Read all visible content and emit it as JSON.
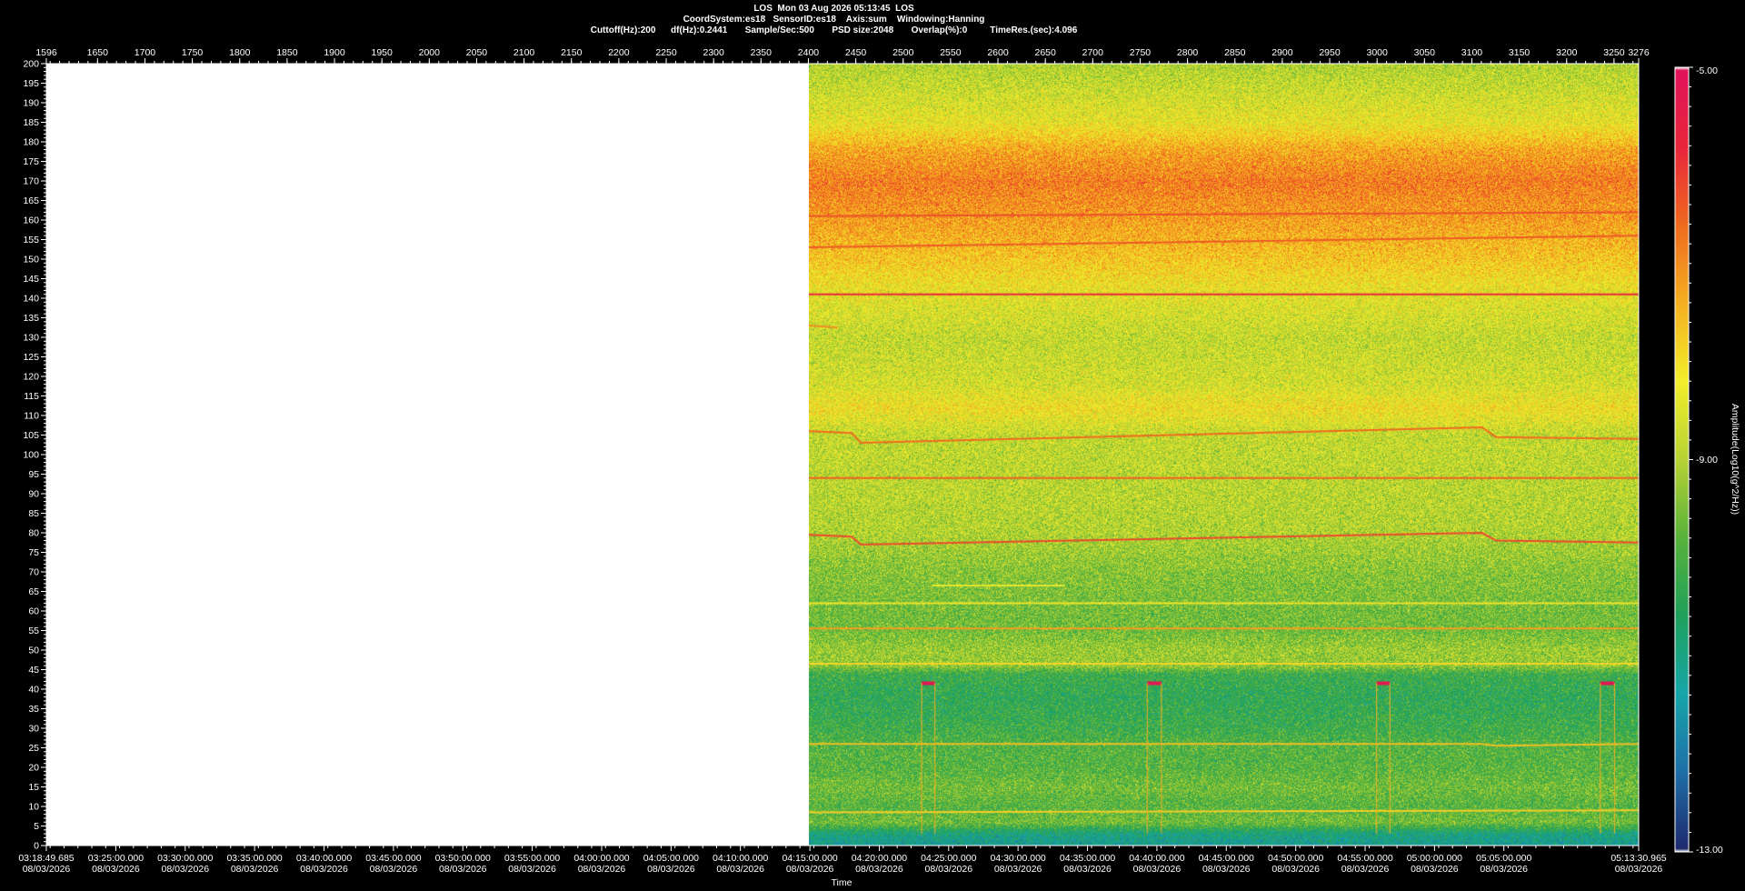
{
  "header": {
    "line1": "LOS  Mon 03 Aug 2026 05:13:45  LOS",
    "line2": "CoordSystem:es18   SensorID:es18    Axis:sum    Windowing:Hanning",
    "line3": "Cuttoff(Hz):200      df(Hz):0.2441       Sample/Sec:500       PSD size:2048       Overlap(%):0         TimeRes.(sec):4.096"
  },
  "chart_data": {
    "type": "heatmap",
    "title": "LOS  Mon 03 Aug 2026 05:13:45  LOS",
    "xlabel": "Time",
    "ylabel": "",
    "ylim": [
      0,
      200
    ],
    "y_ticks": [
      0,
      5,
      10,
      15,
      20,
      25,
      30,
      35,
      40,
      45,
      50,
      55,
      60,
      65,
      70,
      75,
      80,
      85,
      90,
      95,
      100,
      105,
      110,
      115,
      120,
      125,
      130,
      135,
      140,
      145,
      150,
      155,
      160,
      165,
      170,
      175,
      180,
      185,
      190,
      195,
      200
    ],
    "top_axis_range": [
      1596,
      3276
    ],
    "top_axis_ticks": [
      1596,
      1650,
      1700,
      1750,
      1800,
      1850,
      1900,
      1950,
      2000,
      2050,
      2100,
      2150,
      2200,
      2250,
      2300,
      2350,
      2400,
      2450,
      2500,
      2550,
      2600,
      2650,
      2700,
      2750,
      2800,
      2850,
      2900,
      2950,
      3000,
      3050,
      3100,
      3150,
      3200,
      3250,
      3276
    ],
    "data_start_index": 2400,
    "time_ticks": [
      {
        "index": 1596,
        "time": "03:18:49.685",
        "date": "08/03/2026"
      },
      {
        "index": 1669.3,
        "time": "03:25:00.000",
        "date": "08/03/2026"
      },
      {
        "index": 1742.5,
        "time": "03:30:00.000",
        "date": "08/03/2026"
      },
      {
        "index": 1815.7,
        "time": "03:35:00.000",
        "date": "08/03/2026"
      },
      {
        "index": 1889,
        "time": "03:40:00.000",
        "date": "08/03/2026"
      },
      {
        "index": 1962.2,
        "time": "03:45:00.000",
        "date": "08/03/2026"
      },
      {
        "index": 2035.4,
        "time": "03:50:00.000",
        "date": "08/03/2026"
      },
      {
        "index": 2108.6,
        "time": "03:55:00.000",
        "date": "08/03/2026"
      },
      {
        "index": 2181.9,
        "time": "04:00:00.000",
        "date": "08/03/2026"
      },
      {
        "index": 2255.1,
        "time": "04:05:00.000",
        "date": "08/03/2026"
      },
      {
        "index": 2328.3,
        "time": "04:10:00.000",
        "date": "08/03/2026"
      },
      {
        "index": 2401.6,
        "time": "04:15:00.000",
        "date": "08/03/2026"
      },
      {
        "index": 2474.8,
        "time": "04:20:00.000",
        "date": "08/03/2026"
      },
      {
        "index": 2548,
        "time": "04:25:00.000",
        "date": "08/03/2026"
      },
      {
        "index": 2621.2,
        "time": "04:30:00.000",
        "date": "08/03/2026"
      },
      {
        "index": 2694.5,
        "time": "04:35:00.000",
        "date": "08/03/2026"
      },
      {
        "index": 2767.7,
        "time": "04:40:00.000",
        "date": "08/03/2026"
      },
      {
        "index": 2840.9,
        "time": "04:45:00.000",
        "date": "08/03/2026"
      },
      {
        "index": 2914.2,
        "time": "04:50:00.000",
        "date": "08/03/2026"
      },
      {
        "index": 2987.4,
        "time": "04:55:00.000",
        "date": "08/03/2026"
      },
      {
        "index": 3060.6,
        "time": "05:00:00.000",
        "date": "08/03/2026"
      },
      {
        "index": 3133.8,
        "time": "05:05:00.000",
        "date": "08/03/2026"
      },
      {
        "index": 3276,
        "time": "05:13:30.965",
        "date": "08/03/2026"
      }
    ],
    "colorbar": {
      "label": "Amplitude(Log10(g^2/Hz))",
      "max": "-5.00",
      "mid": "-9.00",
      "min": "-13.00",
      "range": [
        -13,
        -5
      ],
      "colors": [
        "#ffffff",
        "#1e2a6e",
        "#1e6fa8",
        "#16a6a8",
        "#1ea05a",
        "#58b23a",
        "#b7d233",
        "#f2ee2a",
        "#f5b021",
        "#ef6b1e",
        "#e8263a",
        "#e0125a",
        "#ffffff"
      ]
    },
    "background_levels": [
      {
        "f": 0,
        "v": -11.3
      },
      {
        "f": 3,
        "v": -11.0
      },
      {
        "f": 6,
        "v": -9.6
      },
      {
        "f": 10,
        "v": -9.9
      },
      {
        "f": 15,
        "v": -9.6
      },
      {
        "f": 20,
        "v": -9.9
      },
      {
        "f": 25,
        "v": -9.9
      },
      {
        "f": 30,
        "v": -10.2
      },
      {
        "f": 38,
        "v": -10.4
      },
      {
        "f": 44,
        "v": -10.2
      },
      {
        "f": 46,
        "v": -9.3
      },
      {
        "f": 50,
        "v": -9.2
      },
      {
        "f": 55,
        "v": -9.6
      },
      {
        "f": 60,
        "v": -9.6
      },
      {
        "f": 70,
        "v": -9.4
      },
      {
        "f": 80,
        "v": -9.0
      },
      {
        "f": 90,
        "v": -8.9
      },
      {
        "f": 105,
        "v": -8.8
      },
      {
        "f": 112,
        "v": -8.1
      },
      {
        "f": 118,
        "v": -8.6
      },
      {
        "f": 130,
        "v": -8.8
      },
      {
        "f": 140,
        "v": -8.4
      },
      {
        "f": 150,
        "v": -7.7
      },
      {
        "f": 160,
        "v": -7.2
      },
      {
        "f": 170,
        "v": -6.8
      },
      {
        "f": 178,
        "v": -7.3
      },
      {
        "f": 185,
        "v": -8.3
      },
      {
        "f": 195,
        "v": -8.8
      },
      {
        "f": 200,
        "v": -9.0
      }
    ],
    "lines": [
      {
        "points": [
          [
            2400,
            141
          ],
          [
            3276,
            141
          ]
        ],
        "v": -5.8
      },
      {
        "points": [
          [
            2400,
            94
          ],
          [
            3276,
            94
          ]
        ],
        "v": -6.5
      },
      {
        "points": [
          [
            2400,
            161
          ],
          [
            3276,
            162
          ]
        ],
        "v": -6.3
      },
      {
        "points": [
          [
            2400,
            153
          ],
          [
            3276,
            156
          ]
        ],
        "v": -6.4
      },
      {
        "points": [
          [
            2400,
            106
          ],
          [
            2445,
            105.5
          ],
          [
            2455,
            103
          ],
          [
            3110,
            107
          ],
          [
            3125,
            104.5
          ],
          [
            3276,
            104
          ]
        ],
        "v": -6.6
      },
      {
        "points": [
          [
            2400,
            79.5
          ],
          [
            2445,
            79
          ],
          [
            2455,
            77
          ],
          [
            3110,
            80
          ],
          [
            3125,
            78
          ],
          [
            3276,
            77.5
          ]
        ],
        "v": -6.2
      },
      {
        "points": [
          [
            2400,
            55.5
          ],
          [
            3276,
            55.5
          ]
        ],
        "v": -7.2
      },
      {
        "points": [
          [
            2400,
            26
          ],
          [
            3110,
            26
          ],
          [
            3125,
            25.5
          ],
          [
            3276,
            26
          ]
        ],
        "v": -7.6
      },
      {
        "points": [
          [
            2400,
            46.5
          ],
          [
            3276,
            46.5
          ]
        ],
        "v": -7.9
      },
      {
        "points": [
          [
            2400,
            62
          ],
          [
            3276,
            62
          ]
        ],
        "v": -8.1
      },
      {
        "points": [
          [
            2400,
            8.5
          ],
          [
            3276,
            9
          ]
        ],
        "v": -7.8
      },
      {
        "points": [
          [
            2400,
            133
          ],
          [
            2430,
            132.5
          ]
        ],
        "v": -7.0
      },
      {
        "points": [
          [
            2530,
            66.5
          ],
          [
            2670,
            66.5
          ]
        ],
        "v": -8.4
      }
    ],
    "steps": [
      {
        "from": 2519,
        "to": 2533,
        "level": 41.5,
        "v": -5.2
      },
      {
        "from": 2757,
        "to": 2772,
        "level": 41.5,
        "v": -5.2
      },
      {
        "from": 2999,
        "to": 3013,
        "level": 41.5,
        "v": -5.2
      },
      {
        "from": 3235,
        "to": 3250,
        "level": 41.5,
        "v": -5.2
      }
    ]
  }
}
